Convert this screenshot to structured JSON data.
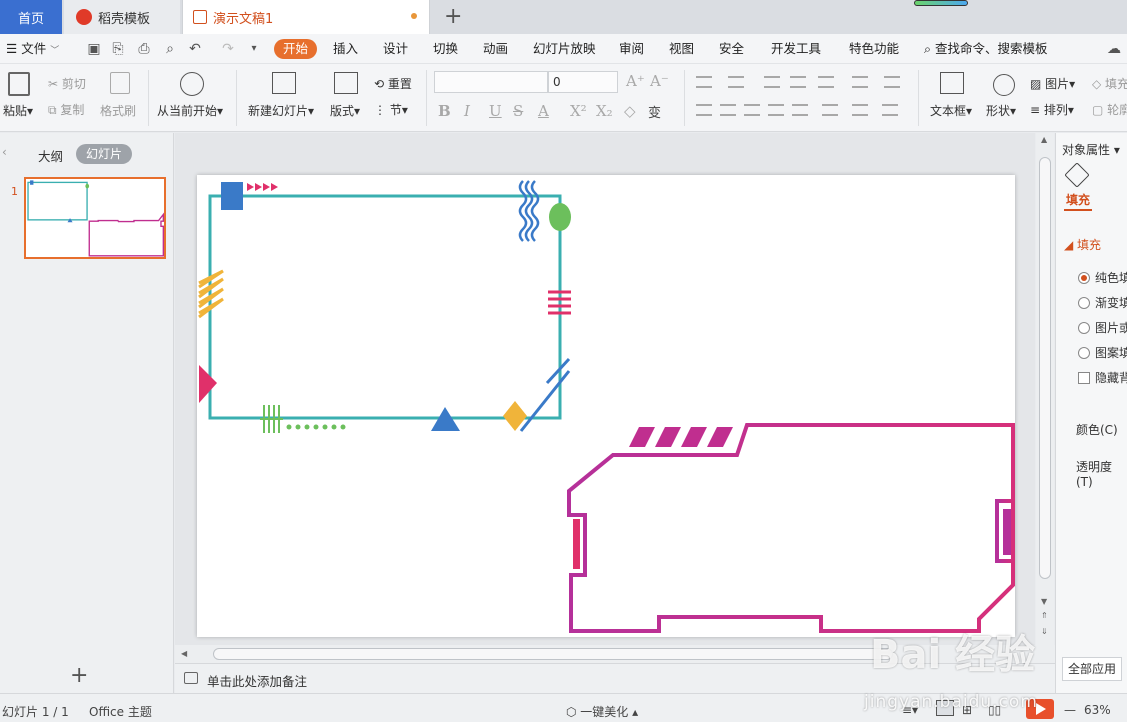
{
  "tabs": {
    "home": "首页",
    "template": "稻壳模板",
    "document": "演示文稿1"
  },
  "menu": {
    "file": "文件",
    "items": [
      "开始",
      "插入",
      "设计",
      "切换",
      "动画",
      "幻灯片放映",
      "审阅",
      "视图",
      "安全",
      "开发工具",
      "特色功能"
    ],
    "search": "查找命令、搜索模板"
  },
  "ribbon": {
    "paste": "粘贴",
    "cut": "剪切",
    "copy": "复制",
    "format_painter": "格式刷",
    "play_from_current": "从当前开始",
    "new_slide": "新建幻灯片",
    "layout": "版式",
    "reset": "重置",
    "section": "节",
    "font_size": "0",
    "textbox": "文本框",
    "shape": "形状",
    "picture": "图片",
    "arrange": "排列",
    "fill": "填充",
    "outline": "轮廓"
  },
  "left_panel": {
    "outline_tab": "大纲",
    "slides_tab": "幻灯片",
    "slide_number": "1"
  },
  "notes": {
    "placeholder": "单击此处添加备注"
  },
  "right_panel": {
    "title": "对象属性",
    "fill_tab": "填充",
    "fill_section": "填充",
    "options": [
      "纯色填充",
      "渐变填充",
      "图片或纹理填充",
      "图案填充"
    ],
    "selected_option": "纯色填充",
    "hide_bg": "隐藏背景图形",
    "color_label": "颜色(C)",
    "opacity_label": "透明度(T)",
    "apply_all": "全部应用"
  },
  "status": {
    "slide_info": "幻灯片 1 / 1",
    "theme": "Office 主题",
    "beautify": "一键美化",
    "zoom": "63%"
  },
  "watermark": {
    "brand": "Bai 经验",
    "site": "jingyan.baidu.com"
  },
  "colors": {
    "accent_orange": "#e76f2d",
    "home_tab_blue": "#3a6fd0",
    "frame_teal": "#3aafb0",
    "frame_magenta": "#c02e8f",
    "shape_blue": "#3a7ac8",
    "shape_green": "#6cbf5c",
    "shape_yellow": "#f0b43a",
    "shape_pink": "#e0306a"
  }
}
